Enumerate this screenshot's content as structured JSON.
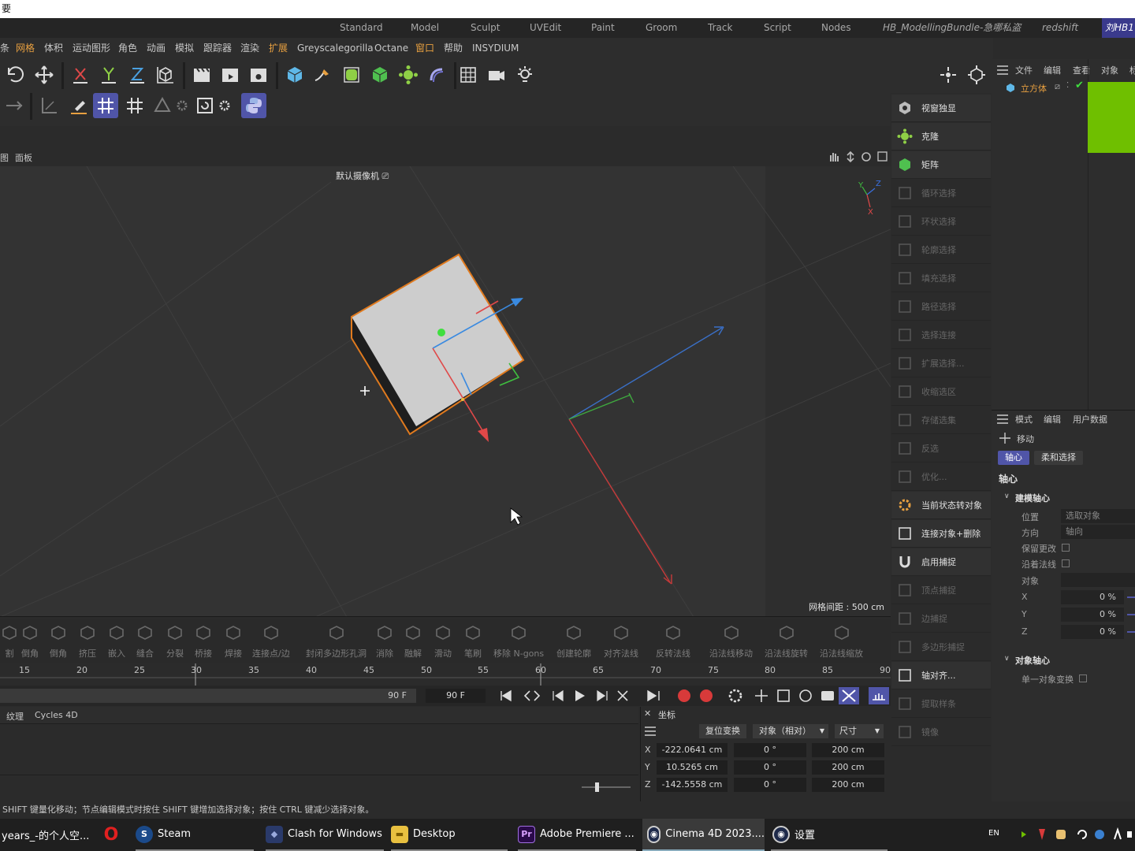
{
  "title_char": "要",
  "layouts": [
    "Standard",
    "Model",
    "Sculpt",
    "UVEdit",
    "Paint",
    "Groom",
    "Track",
    "Script",
    "Nodes",
    "HB_ModellingBundle-急哪私盗",
    "redshift",
    "刘HB1"
  ],
  "menu": [
    "条",
    "网格",
    "体积",
    "运动图形",
    "角色",
    "动画",
    "模拟",
    "跟踪器",
    "渲染",
    "扩展",
    "Greyscalegorilla",
    "Octane",
    "窗口",
    "帮助",
    "INSYDIUM"
  ],
  "viewport": {
    "header_left": "图",
    "header_panel": "面板",
    "camera": "默认摄像机",
    "grid_spacing": "网格间距 : 500 cm",
    "axis_y": "Y",
    "axis_z": "Z",
    "axis_x": "X"
  },
  "bottom_tools": [
    "割",
    "倒角",
    "倒角",
    "挤压",
    "嵌入",
    "缝合",
    "分裂",
    "桥接",
    "焊接",
    "连接点/边",
    "封闭多边形孔洞",
    "消除",
    "融解",
    "滑动",
    "笔刷",
    "移除 N-gons",
    "创建轮廓",
    "对齐法线",
    "反转法线",
    "沿法线移动",
    "沿法线旋转",
    "沿法线缩放"
  ],
  "timeline": {
    "ticks": [
      "15",
      "20",
      "25",
      "30",
      "35",
      "40",
      "45",
      "50",
      "55",
      "60",
      "65",
      "70",
      "75",
      "80",
      "85",
      "90"
    ],
    "end_frame_a": "90 F",
    "end_frame_b": "90 F"
  },
  "material_tabs": [
    "纹理",
    "Cycles 4D"
  ],
  "coords": {
    "tab": "坐标",
    "reset_btn": "复位变换",
    "mode_select": "对象（相对）",
    "size_select": "尺寸",
    "rows": [
      {
        "axis": "X",
        "pos": "-222.0641 cm",
        "rot": "0 °",
        "size": "200 cm"
      },
      {
        "axis": "Y",
        "pos": "10.5265 cm",
        "rot": "0 °",
        "size": "200 cm"
      },
      {
        "axis": "Z",
        "pos": "-142.5558 cm",
        "rot": "0 °",
        "size": "200 cm"
      }
    ]
  },
  "status": "SHIFT 键量化移动；节点编辑模式时按住 SHIFT 键增加选择对象；按住 CTRL 键减少选择对象。",
  "taskbar": [
    {
      "label": "years_-的个人空...",
      "icon": "browser-icon"
    },
    {
      "label": "",
      "icon": "opera-icon"
    },
    {
      "label": "Steam",
      "icon": "steam-icon"
    },
    {
      "label": "Clash for Windows",
      "icon": "clash-icon"
    },
    {
      "label": "Desktop",
      "icon": "folder-icon"
    },
    {
      "label": "Adobe Premiere ...",
      "icon": "premiere-icon"
    },
    {
      "label": "Cinema 4D 2023....",
      "icon": "c4d-icon"
    },
    {
      "label": "设置",
      "icon": "settings-icon"
    }
  ],
  "tray_lang": "EN",
  "palette": [
    {
      "label": "视窗独显",
      "on": true
    },
    {
      "label": "克隆",
      "on": true
    },
    {
      "label": "矩阵",
      "on": true
    },
    {
      "label": "循环选择",
      "on": false
    },
    {
      "label": "环状选择",
      "on": false
    },
    {
      "label": "轮廓选择",
      "on": false
    },
    {
      "label": "填充选择",
      "on": false
    },
    {
      "label": "路径选择",
      "on": false
    },
    {
      "label": "选择连接",
      "on": false
    },
    {
      "label": "扩展选择...",
      "on": false
    },
    {
      "label": "收缩选区",
      "on": false
    },
    {
      "label": "存储选集",
      "on": false
    },
    {
      "label": "反选",
      "on": false
    },
    {
      "label": "优化...",
      "on": false
    },
    {
      "label": "当前状态转对象",
      "on": true
    },
    {
      "label": "连接对象+删除",
      "on": true
    },
    {
      "label": "启用捕捉",
      "on": true
    },
    {
      "label": "顶点捕捉",
      "on": false
    },
    {
      "label": "边捕捉",
      "on": false
    },
    {
      "label": "多边形捕捉",
      "on": false
    },
    {
      "label": "轴对齐...",
      "on": true
    },
    {
      "label": "提取样条",
      "on": false
    },
    {
      "label": "镜像",
      "on": false
    }
  ],
  "object_manager": {
    "menu": [
      "文件",
      "编辑",
      "查看",
      "对象",
      "标"
    ],
    "object_name": "立方体"
  },
  "attributes": {
    "menu": [
      "模式",
      "编辑",
      "用户数据"
    ],
    "tool": "移动",
    "tabs": [
      "轴心",
      "柔和选择"
    ],
    "section": "轴心",
    "group1": "建模轴心",
    "pos_label": "位置",
    "pos_value": "选取对象",
    "dir_label": "方向",
    "dir_value": "轴向",
    "keep_label": "保留更改",
    "normal_label": "沿着法线",
    "obj_label": "对象",
    "x_label": "X",
    "x_value": "0 %",
    "y_label": "Y",
    "y_value": "0 %",
    "z_label": "Z",
    "z_value": "0 %",
    "group2": "对象轴心",
    "single_label": "单一对象变换"
  },
  "colors": {
    "accent": "#5055a8",
    "orange": "#e8a040",
    "green_swatch": "#6fbf00"
  }
}
